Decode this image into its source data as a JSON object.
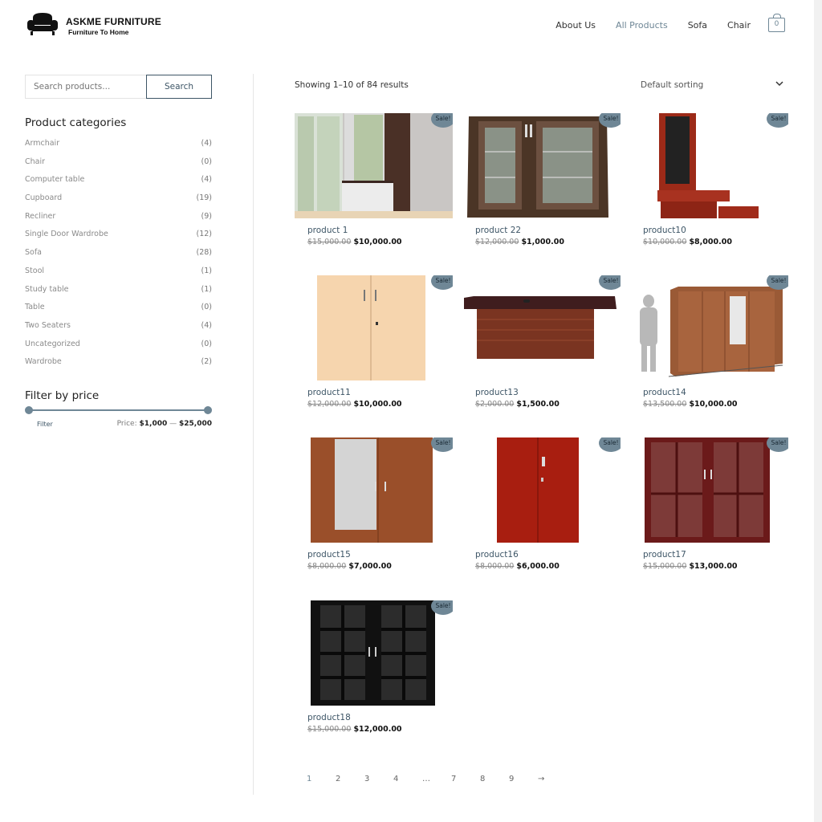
{
  "brand": {
    "name": "ASKME FURNITURE",
    "tagline": "Furniture To Home"
  },
  "nav": {
    "items": [
      "About Us",
      "All Products",
      "Sofa",
      "Chair"
    ],
    "active_index": 1,
    "cart_count": "0"
  },
  "search": {
    "placeholder": "Search products...",
    "button": "Search"
  },
  "categories": {
    "title": "Product categories",
    "items": [
      {
        "name": "Armchair",
        "count": "(4)"
      },
      {
        "name": "Chair",
        "count": "(0)"
      },
      {
        "name": "Computer table",
        "count": "(4)"
      },
      {
        "name": "Cupboard",
        "count": "(19)"
      },
      {
        "name": "Recliner",
        "count": "(9)"
      },
      {
        "name": "Single Door Wardrobe",
        "count": "(12)"
      },
      {
        "name": "Sofa",
        "count": "(28)"
      },
      {
        "name": "Stool",
        "count": "(1)"
      },
      {
        "name": "Study table",
        "count": "(1)"
      },
      {
        "name": "Table",
        "count": "(0)"
      },
      {
        "name": "Two Seaters",
        "count": "(4)"
      },
      {
        "name": "Uncategorized",
        "count": "(0)"
      },
      {
        "name": "Wardrobe",
        "count": "(2)"
      }
    ]
  },
  "price_filter": {
    "title": "Filter by price",
    "button": "Filter",
    "label": "Price:",
    "min": "$1,000",
    "max": "$25,000",
    "separator": "—"
  },
  "results": {
    "count_text": "Showing 1–10 of 84 results",
    "sorting": "Default sorting"
  },
  "sale_badge": "Sale!",
  "products": [
    {
      "name": "product 1",
      "old": "$15,000.00",
      "new": "$10,000.00"
    },
    {
      "name": "product 22",
      "old": "$12,000.00",
      "new": "$1,000.00"
    },
    {
      "name": "product10",
      "old": "$10,000.00",
      "new": "$8,000.00"
    },
    {
      "name": "product11",
      "old": "$12,000.00",
      "new": "$10,000.00"
    },
    {
      "name": "product13",
      "old": "$2,000.00",
      "new": "$1,500.00"
    },
    {
      "name": "product14",
      "old": "$13,500.00",
      "new": "$10,000.00"
    },
    {
      "name": "product15",
      "old": "$8,000.00",
      "new": "$7,000.00"
    },
    {
      "name": "product16",
      "old": "$8,000.00",
      "new": "$6,000.00"
    },
    {
      "name": "product17",
      "old": "$15,000.00",
      "new": "$13,000.00"
    },
    {
      "name": "product18",
      "old": "$15,000.00",
      "new": "$12,000.00"
    }
  ],
  "pagination": [
    "1",
    "2",
    "3",
    "4",
    "…",
    "7",
    "8",
    "9",
    "→"
  ],
  "colors": {
    "accent": "#6f8796",
    "dark_accent": "#3d5566"
  }
}
